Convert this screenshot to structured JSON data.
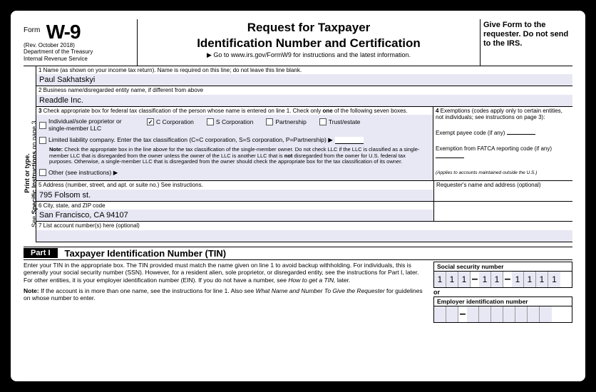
{
  "header": {
    "form_label": "Form",
    "form_number": "W-9",
    "revision": "(Rev. October 2018)",
    "dept1": "Department of the Treasury",
    "dept2": "Internal Revenue Service",
    "title_line1": "Request for Taxpayer",
    "title_line2": "Identification Number and Certification",
    "goto": "▶ Go to www.irs.gov/FormW9 for instructions and the latest information.",
    "give": "Give Form to the requester. Do not send to the IRS."
  },
  "rotate": "Print or type.\nSee Specific Instructions on page 3.",
  "line1": {
    "label": "1 Name (as shown on your income tax return). Name is required on this line; do not leave this line blank.",
    "value": "Paul Sakhatskyi"
  },
  "line2": {
    "label": "2 Business name/disregarded entity name, if different from above",
    "value": "Readdle Inc."
  },
  "line3": {
    "label": "3 Check appropriate box for federal tax classification of the person whose name is entered on line 1. Check only one of the following seven boxes.",
    "opts": {
      "individual": "Individual/sole proprietor or single-member LLC",
      "c_corp": "C Corporation",
      "s_corp": "S Corporation",
      "partnership": "Partnership",
      "trust": "Trust/estate",
      "llc": "Limited liability company. Enter the tax classification (C=C corporation, S=S corporation, P=Partnership) ▶",
      "other": "Other (see instructions) ▶"
    },
    "checked": "c_corp",
    "note": "Note: Check the appropriate box in the line above for the tax classification of the single-member owner. Do not check LLC if the LLC is classified as a single-member LLC that is disregarded from the owner unless the owner of the LLC is another LLC that is not disregarded from the owner for U.S. federal tax purposes. Otherwise, a single-member LLC that is disregarded from the owner should check the appropriate box for the tax classification of its owner."
  },
  "line4": {
    "label": "4 Exemptions (codes apply only to certain entities, not individuals; see instructions on page 3):",
    "exempt_payee": "Exempt payee code (if any)",
    "fatca": "Exemption from FATCA reporting code (if any)",
    "applies": "(Applies to accounts maintained outside the U.S.)"
  },
  "line5": {
    "label": "5 Address (number, street, and apt. or suite no.) See instructions.",
    "value": "795 Folsom st."
  },
  "requester": "Requester's name and address (optional)",
  "line6": {
    "label": "6 City, state, and ZIP code",
    "value": "San Francisco, CA 94107"
  },
  "line7": {
    "label": "7 List account number(s) here (optional)",
    "value": ""
  },
  "part1": {
    "box": "Part I",
    "title": "Taxpayer Identification Number (TIN)",
    "text1": "Enter your TIN in the appropriate box. The TIN provided must match the name given on line 1 to avoid backup withholding. For individuals, this is generally your social security number (SSN). However, for a resident alien, sole proprietor, or disregarded entity, see the instructions for Part I, later. For other entities, it is your employer identification number (EIN). If you do not have a number, see How to get a TIN, later.",
    "text2": "Note: If the account is in more than one name, see the instructions for line 1. Also see What Name and Number To Give the Requester for guidelines on whose number to enter.",
    "ssn_label": "Social security number",
    "ssn": [
      "1",
      "1",
      "1",
      "1",
      "1",
      "1",
      "1",
      "1",
      "1"
    ],
    "or": "or",
    "ein_label": "Employer identification number",
    "ein": [
      "",
      "",
      "",
      "",
      "",
      "",
      "",
      "",
      ""
    ]
  }
}
